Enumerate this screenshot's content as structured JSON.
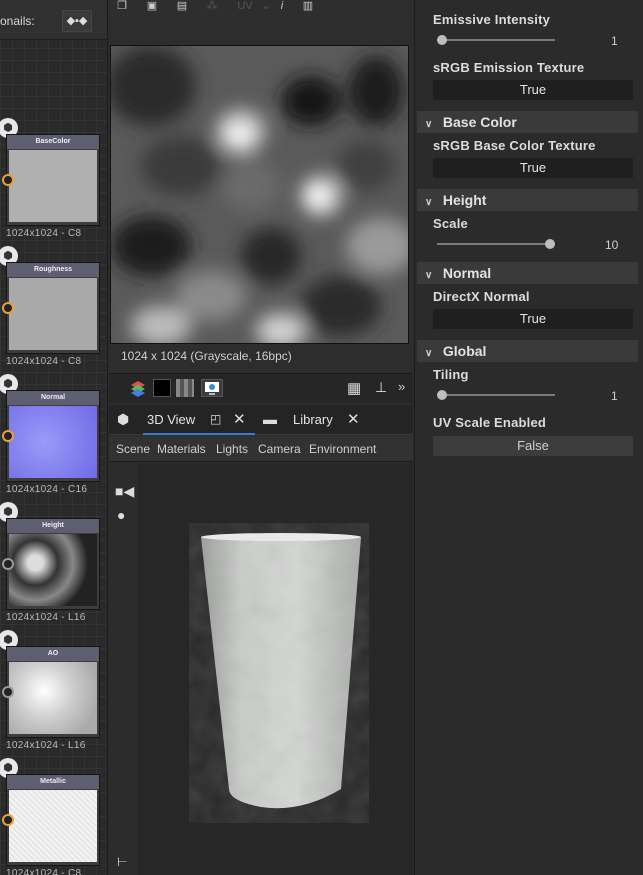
{
  "graph_panel": {
    "thumbnails_label": "onails:",
    "link_icon": "link-icon",
    "nodes": [
      {
        "title": "BaseColor",
        "resolution": "1024x1024 - C8",
        "swatch": "#b0b0b0",
        "port": "orange"
      },
      {
        "title": "Roughness",
        "resolution": "1024x1024 - C8",
        "swatch": "#a9a9a9",
        "port": "orange"
      },
      {
        "title": "Normal",
        "resolution": "1024x1024 - C16",
        "swatch": "#7b78f0",
        "port": "orange"
      },
      {
        "title": "Height",
        "resolution": "1024x1024 - L16",
        "swatch": "#555",
        "port": "gray"
      },
      {
        "title": "AO",
        "resolution": "1024x1024 - L16",
        "swatch": "#d8d8d8",
        "port": "gray"
      },
      {
        "title": "Metallic",
        "resolution": "1024x1024 - C8",
        "swatch": "#f2f2f2",
        "port": "orange"
      }
    ]
  },
  "view2d": {
    "toolbar_uv_label": "UV",
    "resolution_info": "1024 x 1024 (Grayscale, 16bpc)"
  },
  "view3d": {
    "tabs": [
      {
        "label": "3D View",
        "active": true
      },
      {
        "label": "Library",
        "active": false
      }
    ],
    "menu": [
      "Scene",
      "Materials",
      "Lights",
      "Camera",
      "Environment"
    ]
  },
  "properties": {
    "emissive_intensity": {
      "label": "Emissive Intensity",
      "value": "1",
      "fraction": 0.0
    },
    "srgb_emission": {
      "label": "sRGB Emission Texture",
      "value": "True"
    },
    "base_color_section": "Base Color",
    "srgb_base_color": {
      "label": "sRGB Base Color Texture",
      "value": "True"
    },
    "height_section": "Height",
    "scale": {
      "label": "Scale",
      "value": "10",
      "fraction": 1.0
    },
    "normal_section": "Normal",
    "directx_normal": {
      "label": "DirectX Normal",
      "value": "True"
    },
    "global_section": "Global",
    "tiling": {
      "label": "Tiling",
      "value": "1",
      "fraction": 0.0
    },
    "uv_scale": {
      "label": "UV Scale Enabled",
      "value": "False"
    }
  },
  "colors": {
    "accent_orange": "#e7a13b",
    "tab_accent": "#3a7ad0",
    "node_title": "#5e5e73"
  }
}
